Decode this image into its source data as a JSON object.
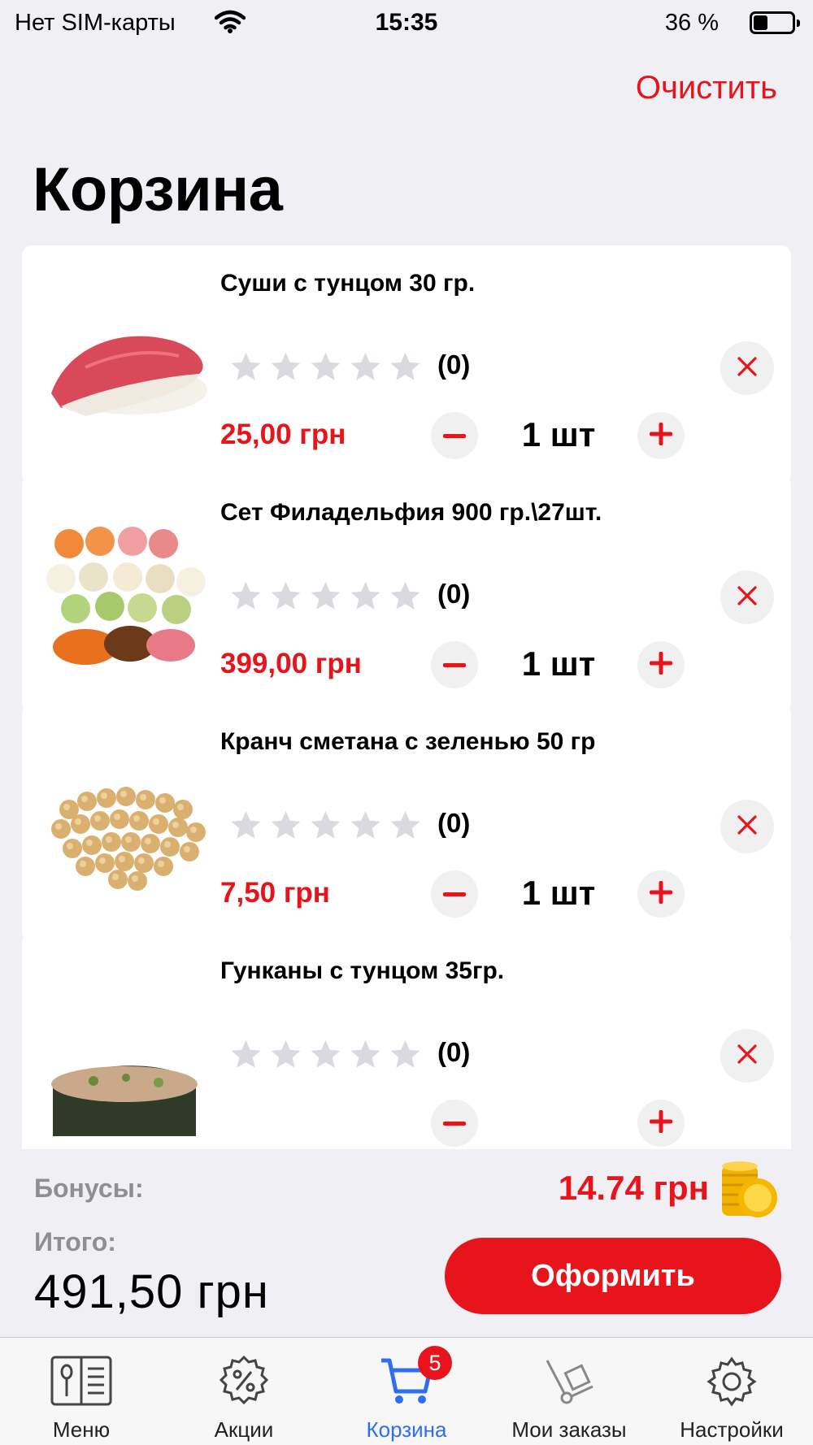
{
  "status_bar": {
    "carrier": "Нет SIM-карты",
    "time": "15:35",
    "battery": "36 %",
    "battery_level": 0.36
  },
  "header": {
    "clear_label": "Очистить",
    "title": "Корзина"
  },
  "cart": {
    "items": [
      {
        "name": "Суши с тунцом 30 гр.",
        "rating_count": "(0)",
        "price": "25,00 грн",
        "quantity": "1 шт",
        "image": "tuna-nigiri"
      },
      {
        "name": "Сет Филадельфия 900 гр.\\27шт.",
        "rating_count": "(0)",
        "price": "399,00 грн",
        "quantity": "1 шт",
        "image": "philadelphia-set"
      },
      {
        "name": "Кранч сметана с зеленью 50 гр",
        "rating_count": "(0)",
        "price": "7,50 грн",
        "quantity": "1 шт",
        "image": "crunch-balls"
      },
      {
        "name": "Гунканы с тунцом 35гр.",
        "rating_count": "(0)",
        "price": "",
        "quantity": "",
        "image": "gunkan-tuna"
      }
    ]
  },
  "summary": {
    "bonus_label": "Бонусы:",
    "bonus_value": "14.74 грн",
    "total_label": "Итого:",
    "total_value": "491,50 грн",
    "checkout_label": "Оформить"
  },
  "tab_bar": {
    "tabs": [
      {
        "label": "Меню",
        "icon": "menu-book-icon"
      },
      {
        "label": "Акции",
        "icon": "discount-gear-icon"
      },
      {
        "label": "Корзина",
        "icon": "cart-icon",
        "badge": "5",
        "active": true
      },
      {
        "label": "Мои заказы",
        "icon": "hand-truck-icon"
      },
      {
        "label": "Настройки",
        "icon": "gear-icon"
      }
    ]
  },
  "colors": {
    "accent": "#e8141c",
    "active_tab": "#2e6ef0",
    "background": "#efeff4",
    "star_empty": "#d9d9e0"
  }
}
